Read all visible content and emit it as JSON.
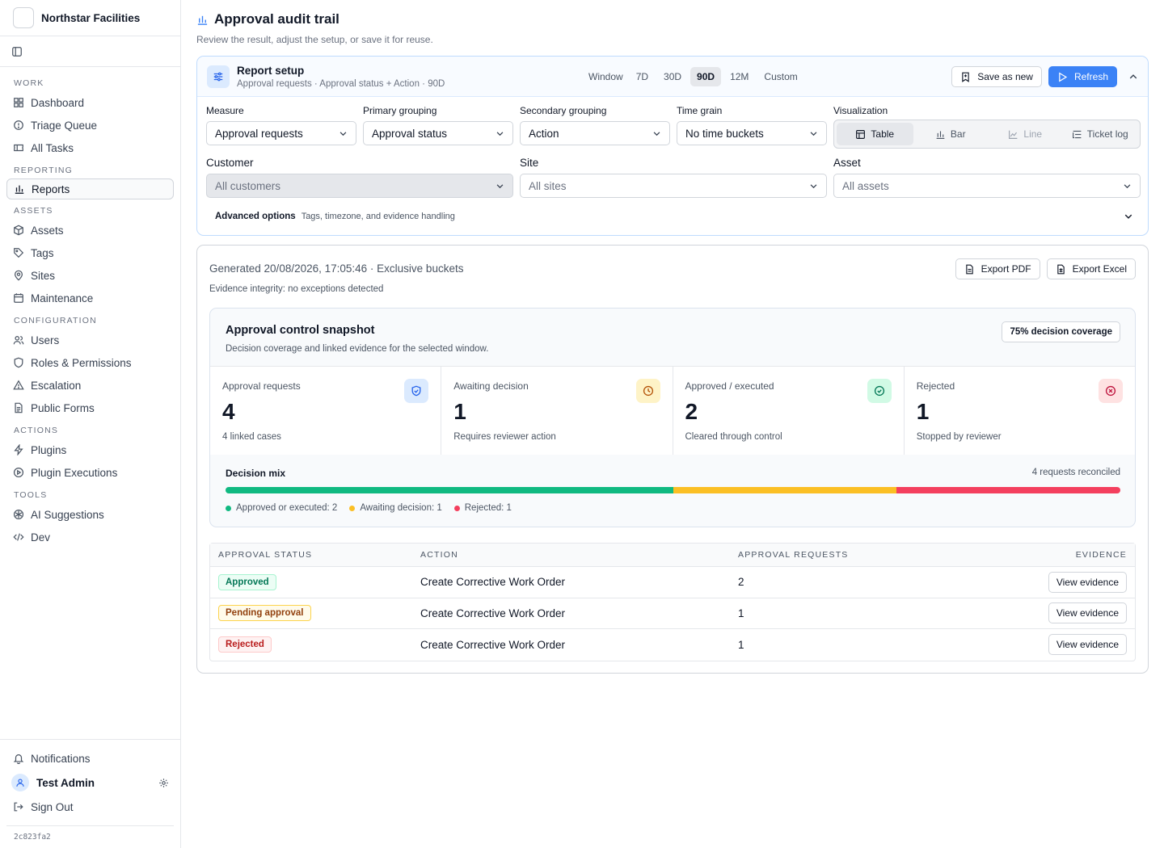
{
  "app": {
    "name": "Northstar Facilities",
    "build": "2c823fa2"
  },
  "sidebar": {
    "sections": [
      {
        "label": "WORK",
        "items": [
          {
            "label": "Dashboard",
            "icon": "dashboard-icon"
          },
          {
            "label": "Triage Queue",
            "icon": "alert-circle-icon"
          },
          {
            "label": "All Tasks",
            "icon": "ticket-icon"
          }
        ]
      },
      {
        "label": "REPORTING",
        "items": [
          {
            "label": "Reports",
            "icon": "bar-chart-icon",
            "active": true
          }
        ]
      },
      {
        "label": "ASSETS",
        "items": [
          {
            "label": "Assets",
            "icon": "box-icon"
          },
          {
            "label": "Tags",
            "icon": "tag-icon"
          },
          {
            "label": "Sites",
            "icon": "map-pin-icon"
          },
          {
            "label": "Maintenance",
            "icon": "calendar-icon"
          }
        ]
      },
      {
        "label": "CONFIGURATION",
        "items": [
          {
            "label": "Users",
            "icon": "users-icon"
          },
          {
            "label": "Roles & Permissions",
            "icon": "shield-icon"
          },
          {
            "label": "Escalation",
            "icon": "warning-triangle-icon"
          },
          {
            "label": "Public Forms",
            "icon": "document-icon"
          }
        ]
      },
      {
        "label": "ACTIONS",
        "items": [
          {
            "label": "Plugins",
            "icon": "lightning-icon"
          },
          {
            "label": "Plugin Executions",
            "icon": "play-circle-icon"
          }
        ]
      },
      {
        "label": "TOOLS",
        "items": [
          {
            "label": "AI Suggestions",
            "icon": "ai-icon"
          },
          {
            "label": "Dev",
            "icon": "code-icon"
          }
        ]
      }
    ],
    "bottom": {
      "notifications": "Notifications",
      "user": "Test Admin",
      "sign_out": "Sign Out"
    }
  },
  "page": {
    "title": "Approval audit trail",
    "subtitle": "Review the result, adjust the setup, or save it for reuse."
  },
  "setup": {
    "title": "Report setup",
    "summary": "Approval requests · Approval status + Action · 90D",
    "window_label": "Window",
    "windows": [
      "7D",
      "30D",
      "90D",
      "12M",
      "Custom"
    ],
    "active_window": "90D",
    "save_label": "Save as new",
    "refresh_label": "Refresh",
    "measure": {
      "label": "Measure",
      "value": "Approval requests"
    },
    "primary": {
      "label": "Primary grouping",
      "value": "Approval status"
    },
    "secondary": {
      "label": "Secondary grouping",
      "value": "Action"
    },
    "grain": {
      "label": "Time grain",
      "value": "No time buckets"
    },
    "viz": {
      "label": "Visualization",
      "options": [
        "Table",
        "Bar",
        "Line",
        "Ticket log"
      ],
      "active": "Table"
    },
    "customer": {
      "label": "Customer",
      "placeholder": "All customers"
    },
    "site": {
      "label": "Site",
      "placeholder": "All sites"
    },
    "asset": {
      "label": "Asset",
      "placeholder": "All assets"
    },
    "advanced": {
      "title": "Advanced options",
      "subtitle": "Tags, timezone, and evidence handling"
    }
  },
  "result": {
    "generated": "Generated 20/08/2026, 17:05:46 · Exclusive buckets",
    "integrity": "Evidence integrity: no exceptions detected",
    "export_pdf": "Export PDF",
    "export_excel": "Export Excel",
    "snapshot": {
      "title": "Approval control snapshot",
      "subtitle": "Decision coverage and linked evidence for the selected window.",
      "coverage": "75% decision coverage",
      "kpis": [
        {
          "label": "Approval requests",
          "value": "4",
          "note": "4 linked cases",
          "icon": "shield-check-icon",
          "color": "#2563eb",
          "bg": "#dbeafe"
        },
        {
          "label": "Awaiting decision",
          "value": "1",
          "note": "Requires reviewer action",
          "icon": "clock-icon",
          "color": "#b45309",
          "bg": "#fef3c7"
        },
        {
          "label": "Approved / executed",
          "value": "2",
          "note": "Cleared through control",
          "icon": "check-circle-icon",
          "color": "#047857",
          "bg": "#d1fae5"
        },
        {
          "label": "Rejected",
          "value": "1",
          "note": "Stopped by reviewer",
          "icon": "x-circle-icon",
          "color": "#be123c",
          "bg": "#fee2e2"
        }
      ],
      "mix_label": "Decision mix",
      "mix_count": "4 requests reconciled",
      "mix": [
        {
          "label": "Approved or executed: 2",
          "value": 2,
          "color": "#10b981"
        },
        {
          "label": "Awaiting decision: 1",
          "value": 1,
          "color": "#fbbf24"
        },
        {
          "label": "Rejected: 1",
          "value": 1,
          "color": "#f43f5e"
        }
      ]
    },
    "table": {
      "headers": [
        "APPROVAL STATUS",
        "ACTION",
        "APPROVAL REQUESTS",
        "EVIDENCE"
      ],
      "rows": [
        {
          "status": "Approved",
          "action": "Create Corrective Work Order",
          "count": "2",
          "evidence": "View evidence"
        },
        {
          "status": "Pending approval",
          "action": "Create Corrective Work Order",
          "count": "1",
          "evidence": "View evidence"
        },
        {
          "status": "Rejected",
          "action": "Create Corrective Work Order",
          "count": "1",
          "evidence": "View evidence"
        }
      ]
    }
  }
}
